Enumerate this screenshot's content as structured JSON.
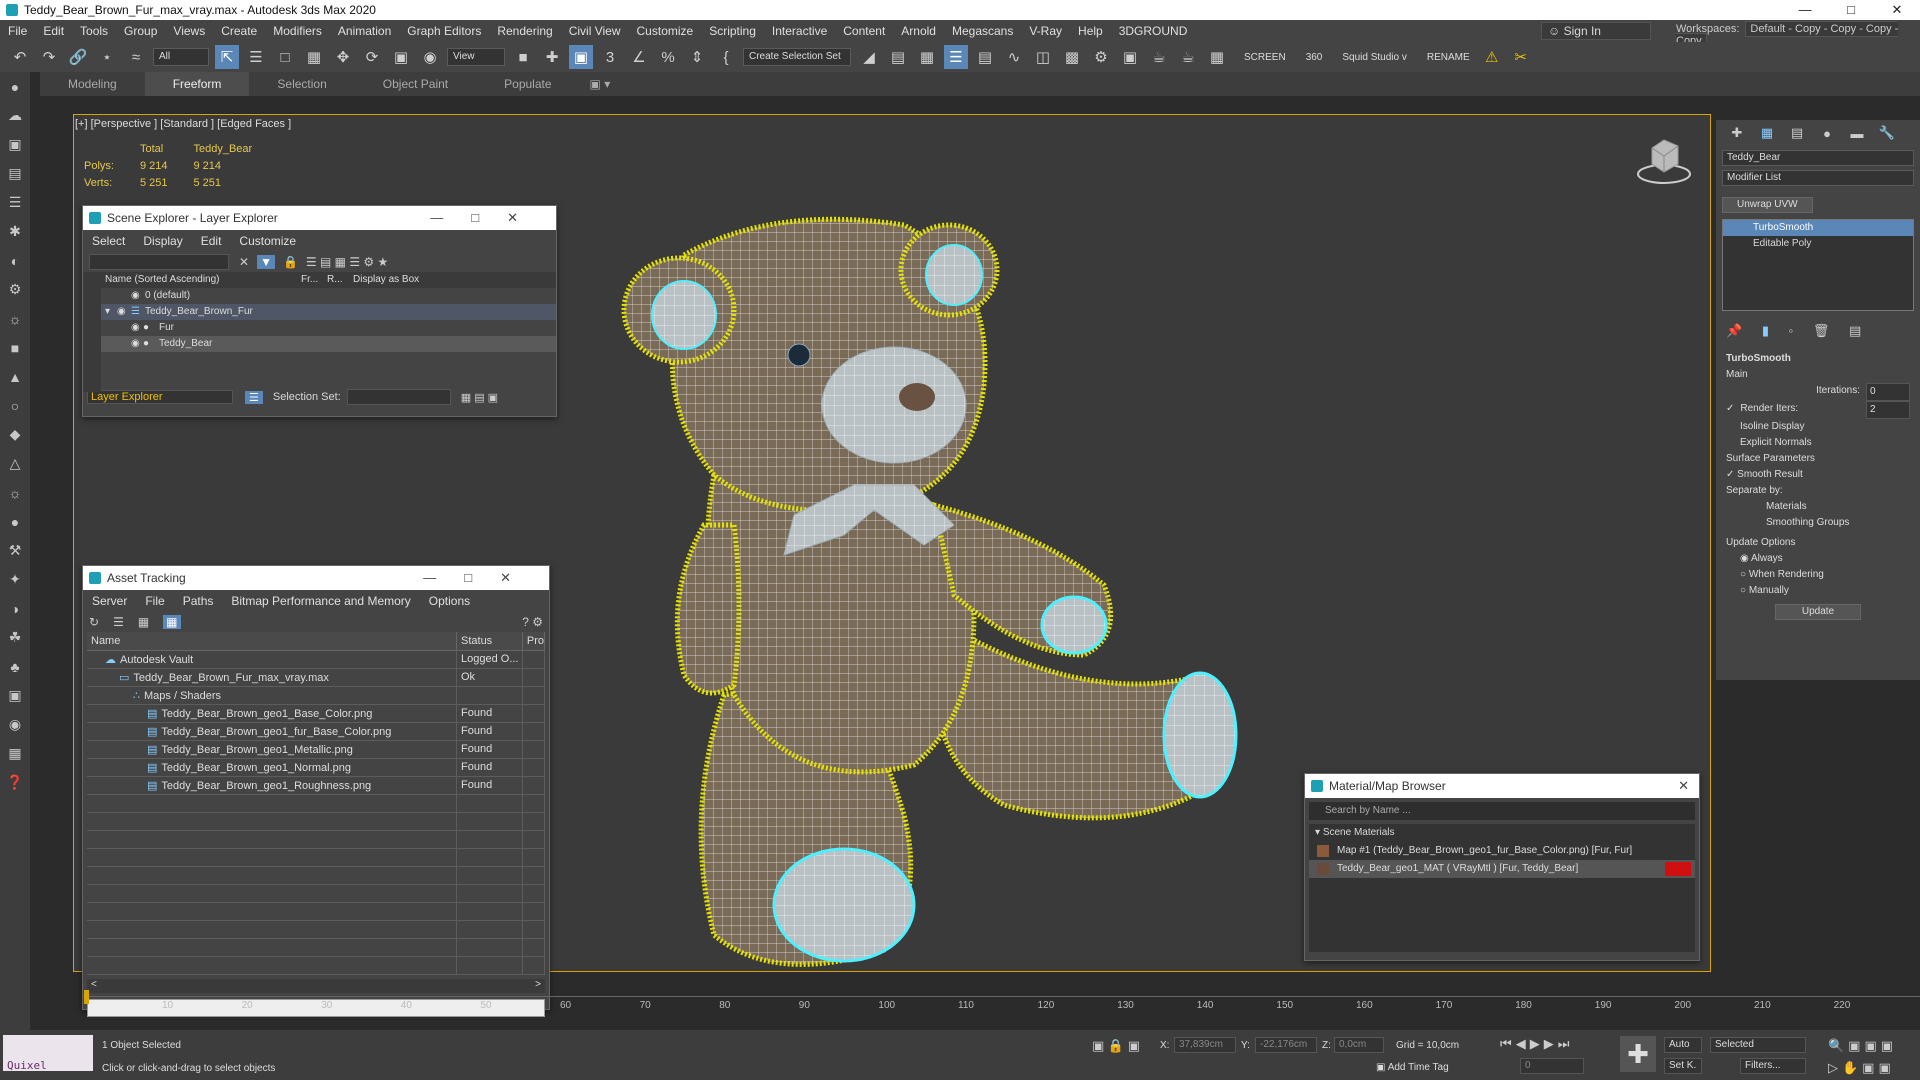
{
  "window": {
    "title": "Teddy_Bear_Brown_Fur_max_vray.max - Autodesk 3ds Max 2020"
  },
  "menu": [
    "File",
    "Edit",
    "Tools",
    "Group",
    "Views",
    "Create",
    "Modifiers",
    "Animation",
    "Graph Editors",
    "Rendering",
    "Civil View",
    "Customize",
    "Scripting",
    "Interactive",
    "Content",
    "Arnold",
    "Megascans",
    "V-Ray",
    "Help",
    "3DGROUND"
  ],
  "signin": "Sign In",
  "workspaces": {
    "label": "Workspaces:",
    "value": "Default - Copy - Copy - Copy - Copy"
  },
  "toolbar": {
    "filter": "All",
    "refcoord": "View",
    "selset": "Create Selection Set",
    "screen": "SCREEN",
    "angle": "360",
    "studio": "Squid Studio v",
    "rename": "RENAME"
  },
  "ribbon": [
    "Modeling",
    "Freeform",
    "Selection",
    "Object Paint",
    "Populate"
  ],
  "viewport": {
    "label": "[+] [Perspective ] [Standard ] [Edged Faces ]",
    "stats": {
      "h_total": "Total",
      "h_obj": "Teddy_Bear",
      "polys_l": "Polys:",
      "polys_t": "9 214",
      "polys_o": "9 214",
      "verts_l": "Verts:",
      "verts_t": "5 251",
      "verts_o": "5 251"
    }
  },
  "scene_explorer": {
    "title": "Scene Explorer - Layer Explorer",
    "menu": [
      "Select",
      "Display",
      "Edit",
      "Customize"
    ],
    "col_name": "Name (Sorted Ascending)",
    "col_fr": "Fr...",
    "col_r": "R...",
    "col_box": "Display as Box",
    "rows": [
      "0 (default)",
      "Teddy_Bear_Brown_Fur",
      "Fur",
      "Teddy_Bear"
    ],
    "footer_mode": "Layer Explorer",
    "footer_selset": "Selection Set:"
  },
  "asset_tracking": {
    "title": "Asset Tracking",
    "menu": [
      "Server",
      "File",
      "Paths",
      "Bitmap Performance and Memory",
      "Options"
    ],
    "col_name": "Name",
    "col_status": "Status",
    "col_pro": "Pro",
    "rows": [
      {
        "name": "Autodesk Vault",
        "status": "Logged O..."
      },
      {
        "name": "Teddy_Bear_Brown_Fur_max_vray.max",
        "status": "Ok"
      },
      {
        "name": "Maps / Shaders",
        "status": ""
      },
      {
        "name": "Teddy_Bear_Brown_geo1_Base_Color.png",
        "status": "Found"
      },
      {
        "name": "Teddy_Bear_Brown_geo1_fur_Base_Color.png",
        "status": "Found"
      },
      {
        "name": "Teddy_Bear_Brown_geo1_Metallic.png",
        "status": "Found"
      },
      {
        "name": "Teddy_Bear_Brown_geo1_Normal.png",
        "status": "Found"
      },
      {
        "name": "Teddy_Bear_Brown_geo1_Roughness.png",
        "status": "Found"
      }
    ]
  },
  "material_browser": {
    "title": "Material/Map Browser",
    "search": "Search by Name ...",
    "section": "Scene Materials",
    "rows": [
      "Map #1 (Teddy_Bear_Brown_geo1_fur_Base_Color.png) [Fur, Fur]",
      "Teddy_Bear_geo1_MAT ( VRayMtl ) [Fur, Teddy_Bear]"
    ]
  },
  "command_panel": {
    "object_name": "Teddy_Bear",
    "modifier_list": "Modifier List",
    "unwrap": "Unwrap UVW",
    "stack": [
      "TurboSmooth",
      "Editable Poly"
    ],
    "turbosmooth": {
      "header": "TurboSmooth",
      "main": "Main",
      "iterations_l": "Iterations:",
      "iterations": "0",
      "render_iters_l": "Render Iters:",
      "render_iters": "2",
      "isoline": "Isoline Display",
      "explicit": "Explicit Normals",
      "surface": "Surface Parameters",
      "smooth": "Smooth Result",
      "separate": "Separate by:",
      "materials": "Materials",
      "smoothing": "Smoothing Groups",
      "update_opts": "Update Options",
      "always": "Always",
      "when_rendering": "When Rendering",
      "manually": "Manually",
      "update": "Update"
    }
  },
  "timeline": {
    "ticks": [
      "10",
      "20",
      "30",
      "40",
      "50",
      "60",
      "70",
      "80",
      "90",
      "100",
      "110",
      "120",
      "130",
      "140",
      "150",
      "160",
      "170",
      "180",
      "190",
      "200",
      "210",
      "220"
    ]
  },
  "status": {
    "quixel": "Quixel Bridge",
    "selected": "1 Object Selected",
    "hint": "Click or click-and-drag to select objects",
    "x_l": "X:",
    "x": "37,839cm",
    "y_l": "Y:",
    "y": "-22,176cm",
    "z_l": "Z:",
    "z": "0,0cm",
    "grid": "Grid = 10,0cm",
    "addtime": "Add Time Tag",
    "auto": "Auto",
    "selected_dd": "Selected",
    "setk": "Set K.",
    "filters": "Filters...",
    "frame": "0"
  },
  "colors": {
    "accent": "#5a87b8",
    "viewport_border": "#d8a400",
    "fur": "#e4e400",
    "wire_select": "#4ef0ff"
  }
}
